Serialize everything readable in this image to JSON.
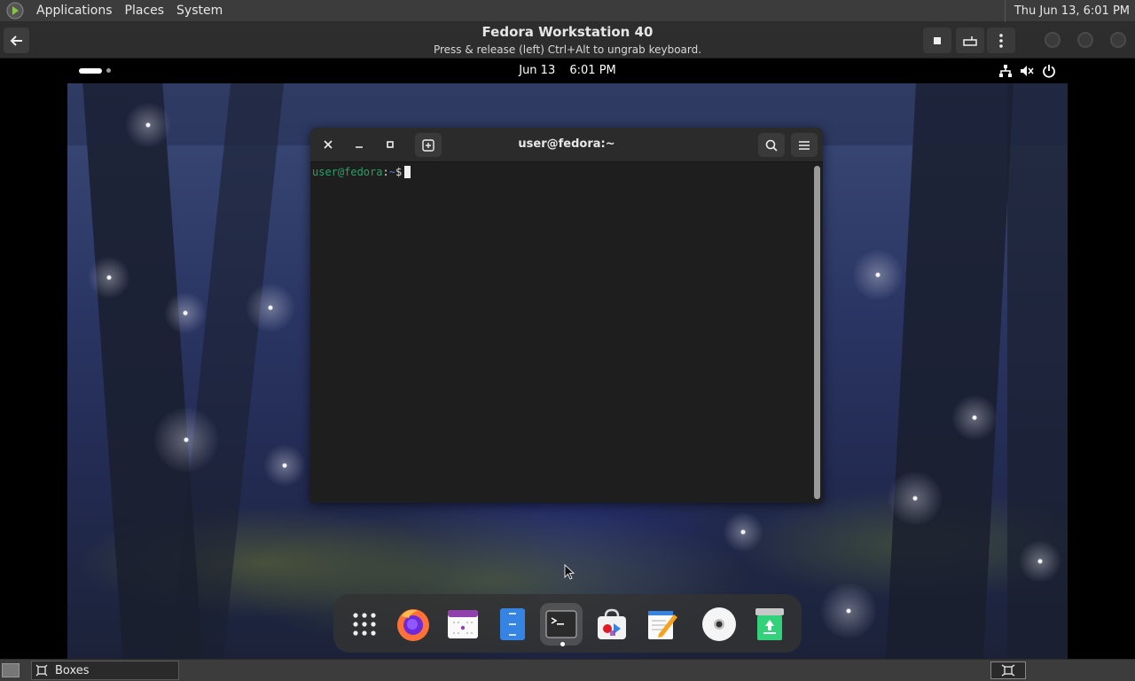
{
  "host_panel": {
    "menus": [
      "Applications",
      "Places",
      "System"
    ],
    "clock": "Thu Jun 13,  6:01 PM"
  },
  "boxes_header": {
    "title": "Fedora Workstation 40",
    "subtitle": "Press & release (left) Ctrl+Alt to ungrab keyboard."
  },
  "gnome_bar": {
    "date": "Jun 13",
    "time": "6:01 PM",
    "tray": [
      "network-icon",
      "volume-muted-icon",
      "power-icon"
    ]
  },
  "terminal": {
    "title": "user@fedora:~",
    "prompt_user": "user@fedora",
    "prompt_sep": ":",
    "prompt_path": "~",
    "prompt_symbol": "$"
  },
  "dash": {
    "items": [
      "app-grid",
      "firefox",
      "calendar",
      "files",
      "terminal",
      "software",
      "text-editor",
      "disks",
      "trash"
    ]
  },
  "host_bottom": {
    "task_label": "Boxes"
  },
  "colors": {
    "panel_bg": "#3c3c3c",
    "terminal_bg": "#1e1e1e",
    "prompt_user": "#26a269",
    "prompt_path": "#4f7fd1"
  }
}
